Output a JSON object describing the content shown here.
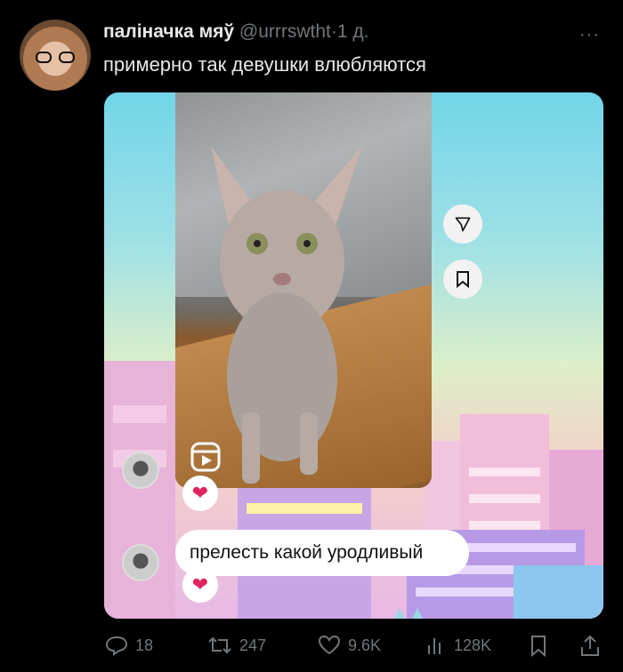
{
  "tweet": {
    "display_name": "паліначка мяў",
    "handle": "@urrrswtht",
    "separator": "·",
    "time": "1 д.",
    "more": "···",
    "text": "примерно так девушки влюбляются"
  },
  "media": {
    "comment_text": "прелесть какой уродливый",
    "heart": "❤",
    "send_icon": "send-icon",
    "save_icon": "bookmark-icon",
    "reels_icon": "reels-icon"
  },
  "stats": {
    "replies": "18",
    "retweets": "247",
    "likes": "9.6K",
    "views": "128K"
  },
  "colors": {
    "background": "#000000",
    "text": "#e7e9ea",
    "muted": "#71767b",
    "heart": "#e0245e"
  }
}
